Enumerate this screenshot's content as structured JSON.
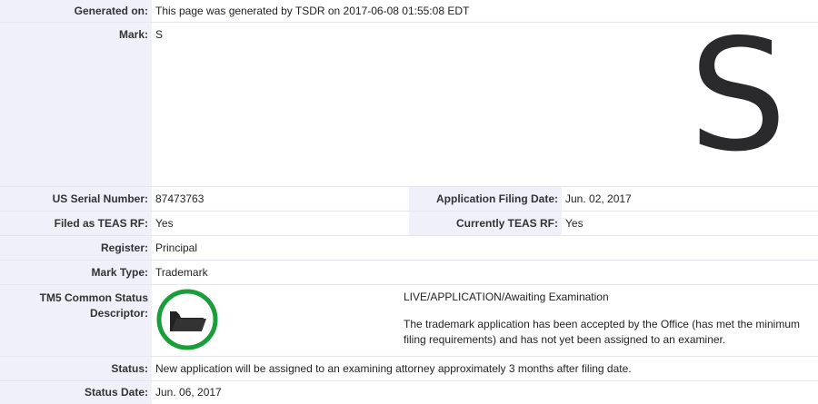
{
  "generated": {
    "label": "Generated on:",
    "value": "This page was generated by TSDR on 2017-06-08 01:55:08 EDT"
  },
  "mark": {
    "label": "Mark:",
    "value": "S",
    "image_text": "S"
  },
  "serial": {
    "label": "US Serial Number:",
    "value": "87473763"
  },
  "filing_date": {
    "label": "Application Filing Date:",
    "value": "Jun. 02, 2017"
  },
  "teas_rf": {
    "label": "Filed as TEAS RF:",
    "value": "Yes"
  },
  "current_teas_rf": {
    "label": "Currently TEAS RF:",
    "value": "Yes"
  },
  "register": {
    "label": "Register:",
    "value": "Principal"
  },
  "mark_type": {
    "label": "Mark Type:",
    "value": "Trademark"
  },
  "tm5": {
    "label_line1": "TM5 Common Status",
    "label_line2": "Descriptor:",
    "icon": "open-folder-icon",
    "ring_color": "#1a9e3a",
    "status": "LIVE/APPLICATION/Awaiting Examination",
    "description": "The trademark application has been accepted by the Office (has met the minimum filing requirements) and has not yet been assigned to an examiner."
  },
  "status": {
    "label": "Status:",
    "value": "New application will be assigned to an examining attorney approximately 3 months after filing date."
  },
  "status_date": {
    "label": "Status Date:",
    "value": "Jun. 06, 2017"
  }
}
